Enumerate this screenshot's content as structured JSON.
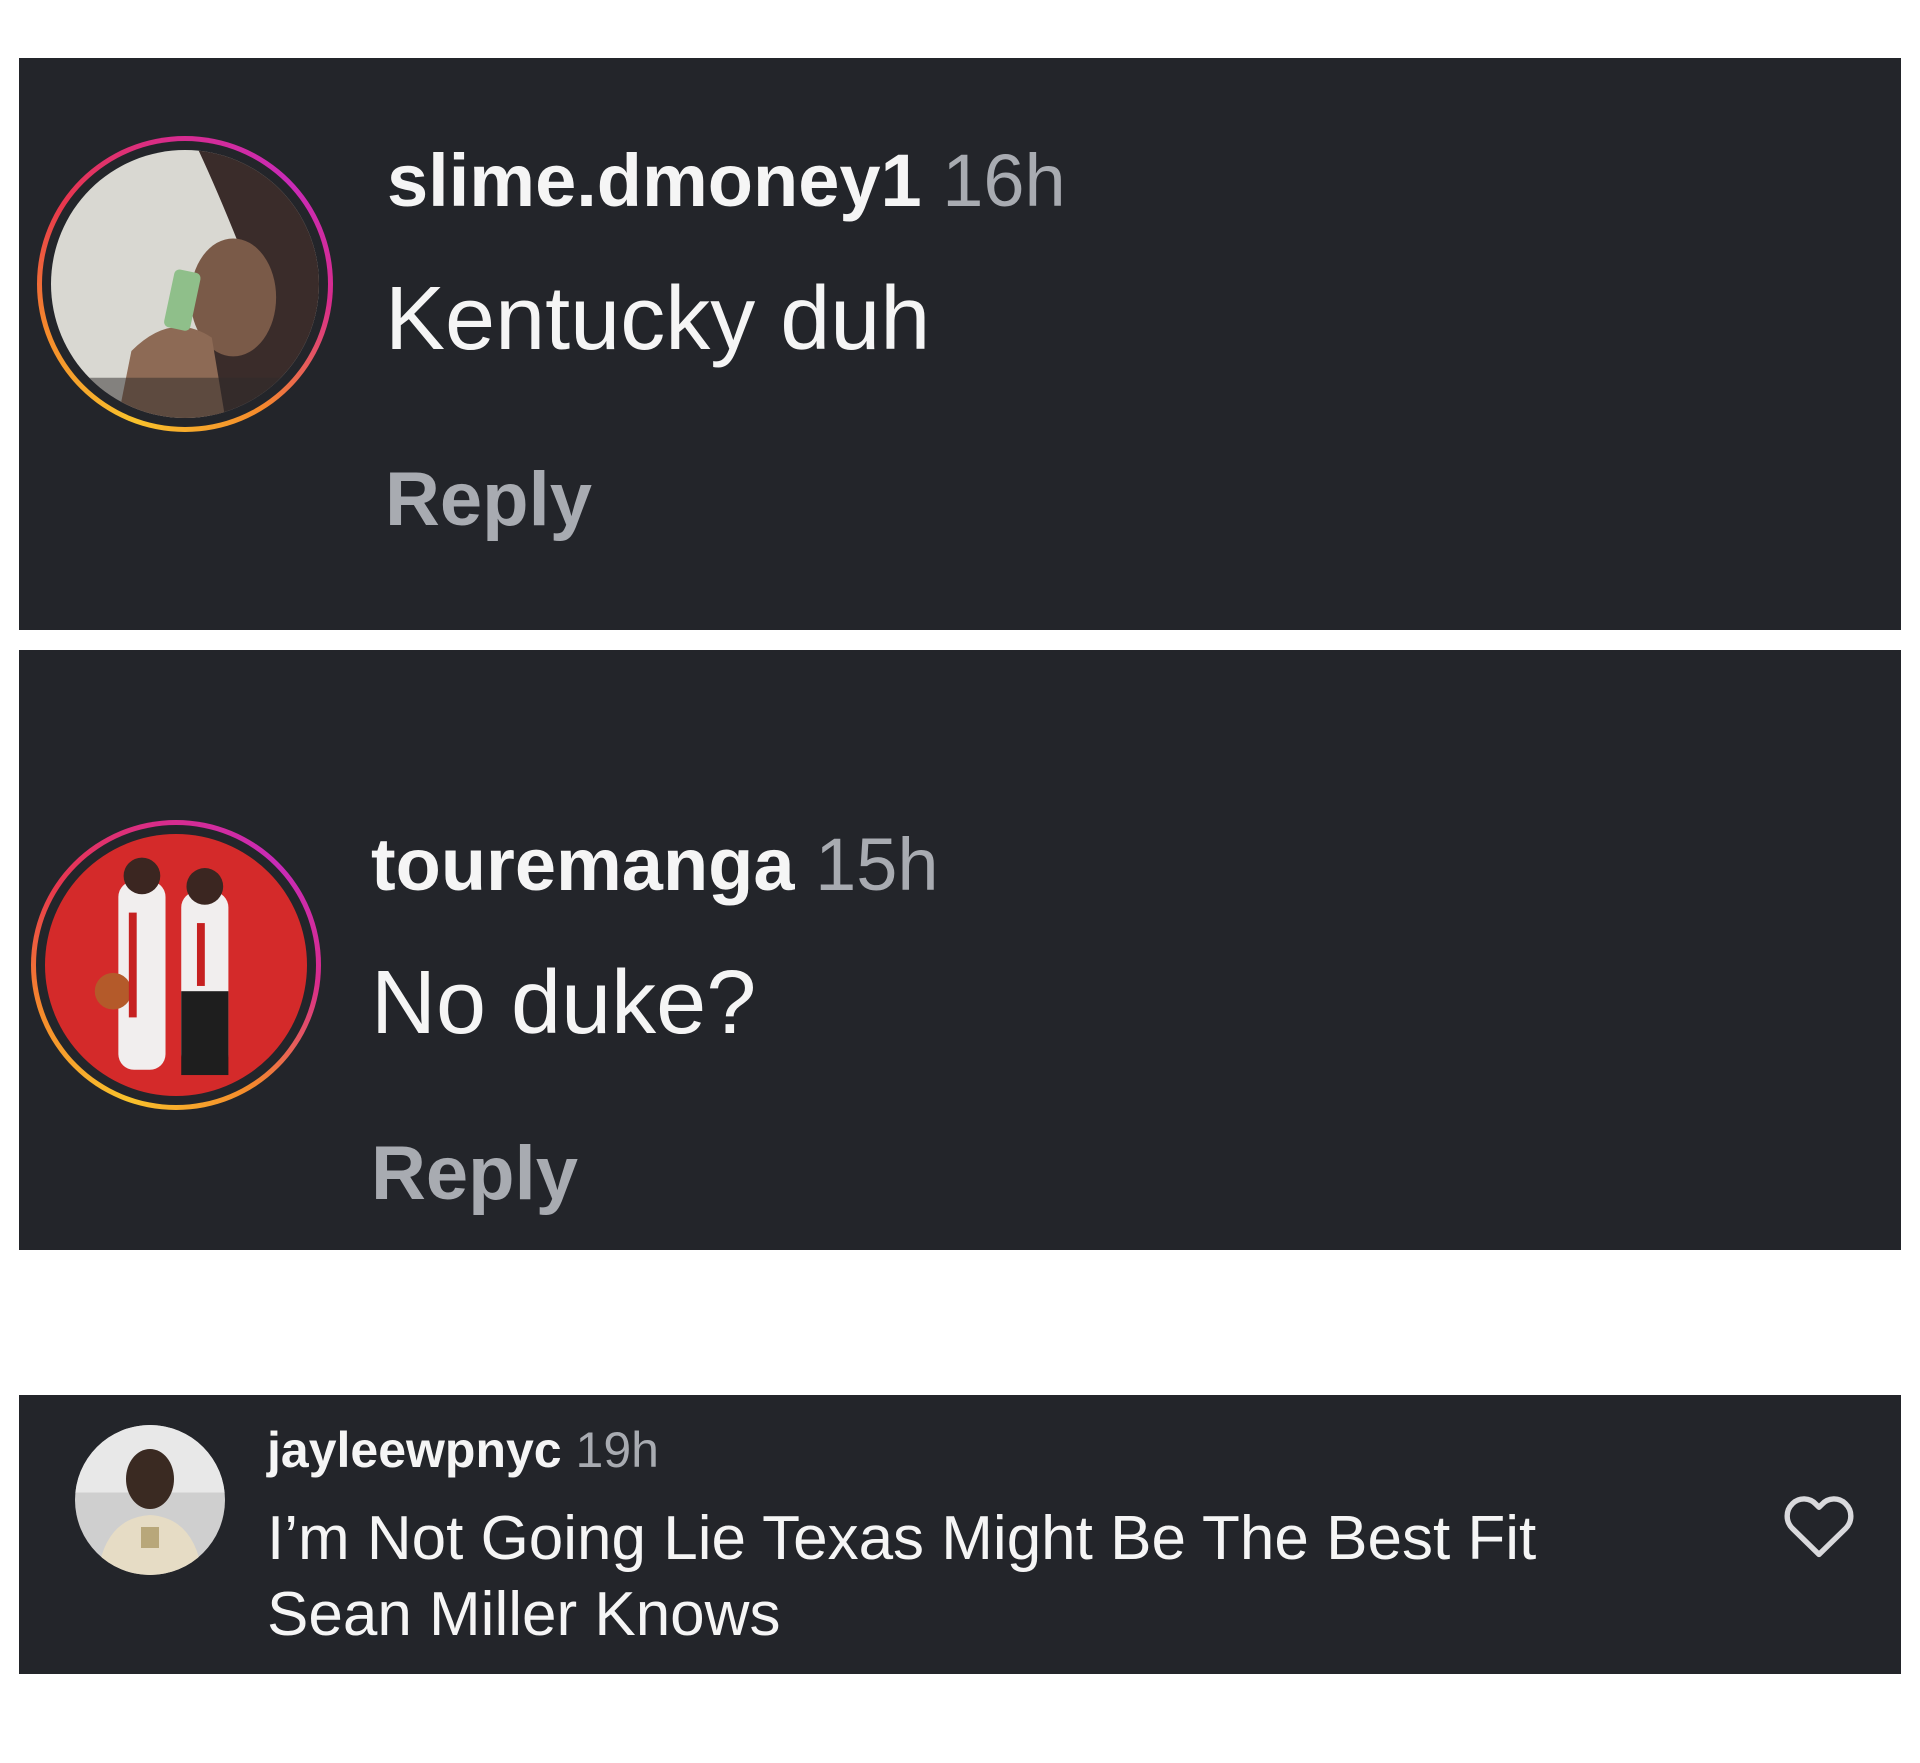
{
  "comments": [
    {
      "username": "slime.dmoney1",
      "time": "16h",
      "text": "Kentucky duh",
      "reply_label": "Reply"
    },
    {
      "username": "touremanga",
      "time": "15h",
      "text": "No duke?",
      "reply_label": "Reply"
    },
    {
      "username": "jayleewpnyc",
      "time": "19h",
      "text_line1": "I’m Not Going Lie Texas Might Be The Best Fit",
      "text_line2": "Sean Miller Knows",
      "like_icon": "heart-outline-icon"
    }
  ],
  "colors": {
    "card_background": "#23252a",
    "primary_text": "#f5f5f5",
    "secondary_text": "#a8abb1",
    "story_ring_gradient": [
      "#f9c22c",
      "#f58a2c",
      "#e8374d",
      "#d82c8c",
      "#c92bb8"
    ]
  }
}
